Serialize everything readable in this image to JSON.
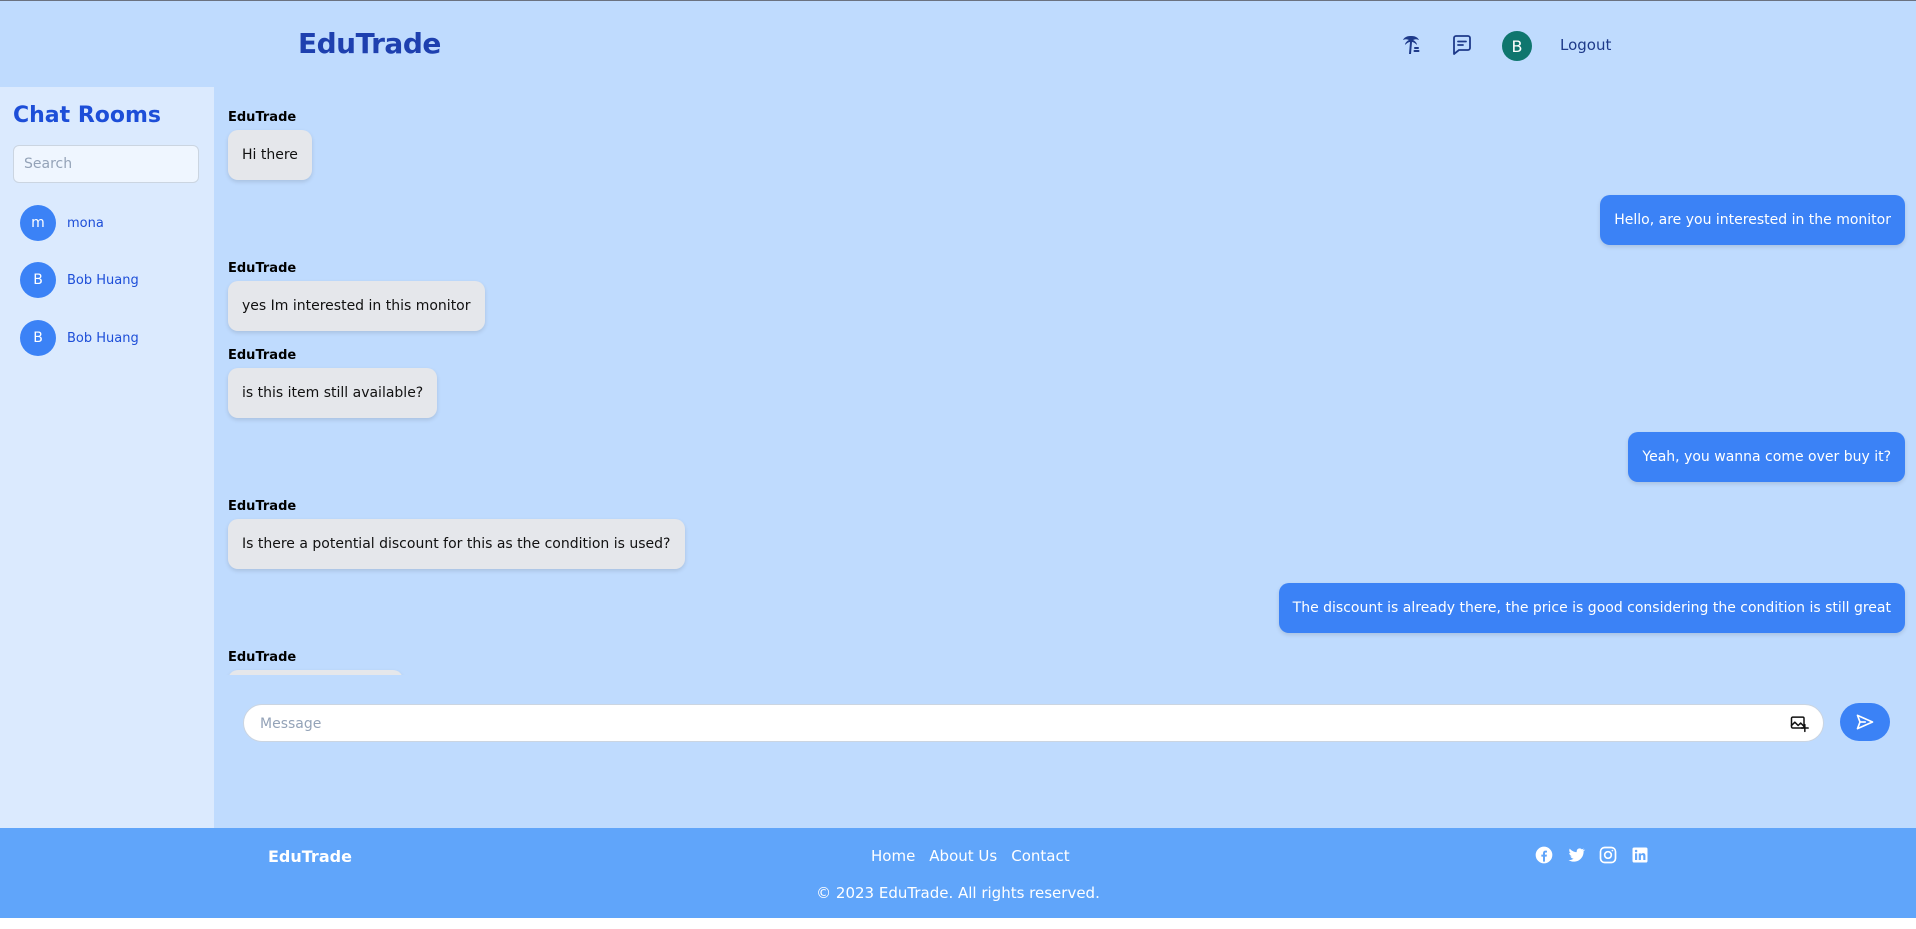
{
  "header": {
    "brand": "EduTrade",
    "avatar_initial": "B",
    "logout_label": "Logout",
    "icons": [
      "palm-tree-icon",
      "chat-icon"
    ]
  },
  "sidebar": {
    "title": "Chat Rooms",
    "search_placeholder": "Search",
    "rooms": [
      {
        "initial": "m",
        "name": "mona"
      },
      {
        "initial": "B",
        "name": "Bob Huang"
      },
      {
        "initial": "B",
        "name": "Bob Huang"
      }
    ]
  },
  "chat": {
    "messages": [
      {
        "direction": "in",
        "sender": "EduTrade",
        "text": "Hi there"
      },
      {
        "direction": "out",
        "text": "Hello, are you interested in the monitor"
      },
      {
        "direction": "in",
        "sender": "EduTrade",
        "text": "yes Im interested in this monitor"
      },
      {
        "direction": "in",
        "sender": "EduTrade",
        "text": "is this item still available?"
      },
      {
        "direction": "out",
        "text": "Yeah, you wanna come over buy it?"
      },
      {
        "direction": "in",
        "sender": "EduTrade",
        "text": "Is there a potential discount for this as the condition is used?"
      },
      {
        "direction": "out",
        "text": "The discount is already there, the price is good considering the condition is still great"
      },
      {
        "direction": "in",
        "sender": "EduTrade",
        "text": ""
      }
    ],
    "input_placeholder": "Message",
    "input_value": ""
  },
  "footer": {
    "brand": "EduTrade",
    "links": [
      "Home",
      "About Us",
      "Contact"
    ],
    "social_icons": [
      "facebook-icon",
      "twitter-icon",
      "instagram-icon",
      "linkedin-icon"
    ],
    "copyright": "© 2023 EduTrade. All rights reserved."
  },
  "colors": {
    "header_bg": "#bfdbfe",
    "sidebar_bg": "#dbeafe",
    "brand": "#1e40af",
    "outgoing_bubble": "#3b82f6",
    "incoming_bubble": "#e5e7eb",
    "avatar_header": "#0f766e",
    "footer_bg": "#60a5fa"
  }
}
